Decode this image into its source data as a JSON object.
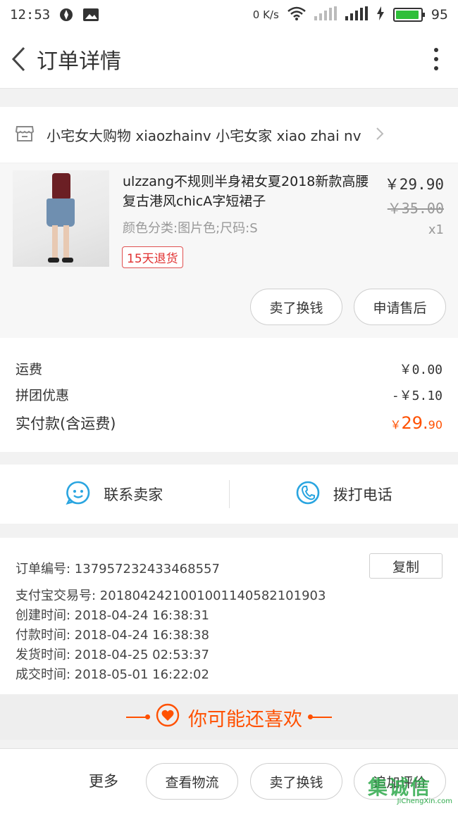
{
  "status_bar": {
    "time": "12:53",
    "net_speed": "0 K/s",
    "battery": "95",
    "battery_level": 0.95,
    "battery_color": "#2fbf3a"
  },
  "header": {
    "title": "订单详情"
  },
  "shop": {
    "name": "小宅女大购物 xiaozhainv 小宅女家 xiao zhai nv"
  },
  "product": {
    "title": "ulzzang不规则半身裙女夏2018新款高腰复古港风chicA字短裙子",
    "spec": "颜色分类:图片色;尺码:S",
    "badge": "15天退货",
    "price": "￥29.90",
    "original_price": "￥35.00",
    "quantity": "x1",
    "actions": {
      "sell": "卖了换钱",
      "aftersale": "申请售后"
    }
  },
  "fees": {
    "shipping_label": "运费",
    "shipping_value": "￥0.00",
    "group_label": "拼团优惠",
    "group_value": "-￥5.10",
    "total_label": "实付款(含运费)",
    "total_symbol": "￥",
    "total_int": "29.",
    "total_dec": "90"
  },
  "contact": {
    "seller": "联系卖家",
    "call": "拨打电话"
  },
  "order_info": {
    "order_no": "订单编号:  1379572324334685​57",
    "copy": "复制",
    "alipay_no": "支付宝交易号:  2018042421001001140582101903",
    "created": "创建时间:  2018-04-24 16:38:31",
    "paid": "付款时间:  2018-04-24 16:38:38",
    "shipped": "发货时间:  2018-04-25 02:53:37",
    "completed": "成交时间:  2018-05-01 16:22:02"
  },
  "recommend": {
    "label": "你可能还喜欢",
    "color": "#ff5000"
  },
  "bottom_bar": {
    "more": "更多",
    "logistics": "查看物流",
    "sell": "卖了换钱",
    "review": "追加评价"
  },
  "watermark": {
    "cn": "集诚信",
    "en": "JiChengXin.com"
  }
}
